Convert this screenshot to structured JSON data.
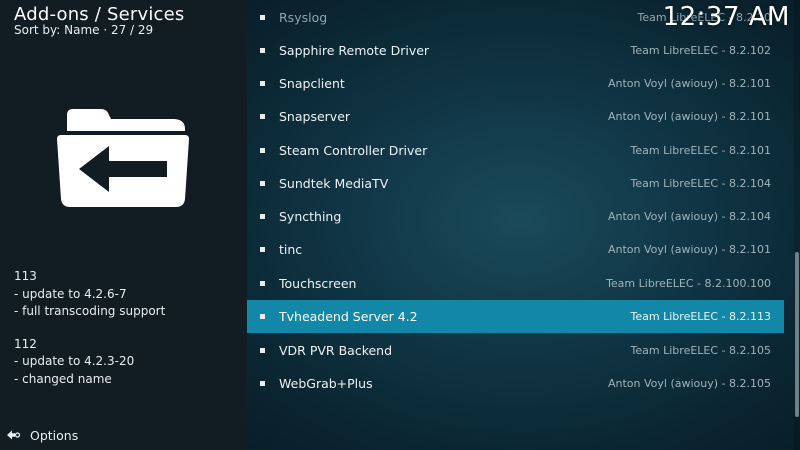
{
  "header": {
    "title": "Add-ons / Services",
    "subtitle": "Sort by: Name  ·  27 / 29"
  },
  "clock": "12:37 AM",
  "changelog": {
    "entries": [
      {
        "version": "113",
        "lines": [
          "- update to 4.2.6-7",
          "- full transcoding support"
        ]
      },
      {
        "version": "112",
        "lines": [
          "- update to 4.2.3-20",
          "- changed name"
        ]
      }
    ]
  },
  "options": {
    "label": "Options",
    "icon": "options-arrow-icon"
  },
  "addons": [
    {
      "name": "Rsyslog",
      "info": "Team LibreELEC - 8.2.10"
    },
    {
      "name": "Sapphire Remote Driver",
      "info": "Team LibreELEC - 8.2.102"
    },
    {
      "name": "Snapclient",
      "info": "Anton Voyl (awiouy) - 8.2.101"
    },
    {
      "name": "Snapserver",
      "info": "Anton Voyl (awiouy) - 8.2.101"
    },
    {
      "name": "Steam Controller Driver",
      "info": "Team LibreELEC - 8.2.101"
    },
    {
      "name": "Sundtek MediaTV",
      "info": "Team LibreELEC - 8.2.104"
    },
    {
      "name": "Syncthing",
      "info": "Anton Voyl (awiouy) - 8.2.104"
    },
    {
      "name": "tinc",
      "info": "Anton Voyl (awiouy) - 8.2.101"
    },
    {
      "name": "Touchscreen",
      "info": "Team LibreELEC - 8.2.100.100"
    },
    {
      "name": "Tvheadend Server 4.2",
      "info": "Team LibreELEC - 8.2.113"
    },
    {
      "name": "VDR PVR Backend",
      "info": "Team LibreELEC - 8.2.105"
    },
    {
      "name": "WebGrab+Plus",
      "info": "Anton Voyl (awiouy) - 8.2.105"
    }
  ],
  "colors": {
    "selection": "#1387a8",
    "left_panel": "#111c23"
  },
  "icons": {
    "folder": "folder-back-arrow-icon"
  }
}
